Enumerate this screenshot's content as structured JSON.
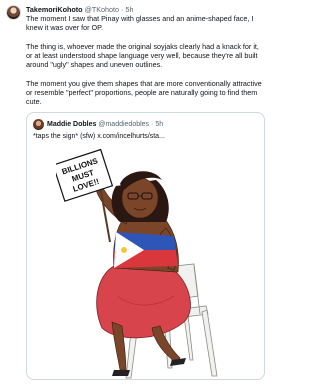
{
  "tweet": {
    "author_name": "TakemoriKohoto",
    "author_handle": "@TKohoto",
    "separator": "·",
    "time": "5h",
    "paragraphs": [
      "The moment I saw that Pinay with glasses and an anime-shaped face, I knew it was over for OP.",
      "The thing is, whoever made the original soyjaks clearly had a knack for it, or at least understood shape language very well, because they're all built around \"ugly\" shapes and uneven outlines.",
      "The moment you give them shapes that are more conventionally attractive or resemble \"perfect\" proportions, people are naturally going to find them cute."
    ]
  },
  "quote": {
    "author_name": "Maddie Dobles",
    "author_handle": "@maddiedobles",
    "separator": "·",
    "time": "5h",
    "text": "*taps the sign* (sfw)  x.com/incelhurts/sta...",
    "image": {
      "sign_text": [
        "BILLIONS",
        "MUST",
        "LOVE!!"
      ],
      "colors": {
        "skin": "#7a4528",
        "hair": "#2a1712",
        "skirt": "#d8444c",
        "flag_blue": "#2e56b8",
        "flag_red": "#d9363e",
        "sun_yellow": "#f0c640",
        "chair": "#f1f1ef"
      }
    }
  }
}
